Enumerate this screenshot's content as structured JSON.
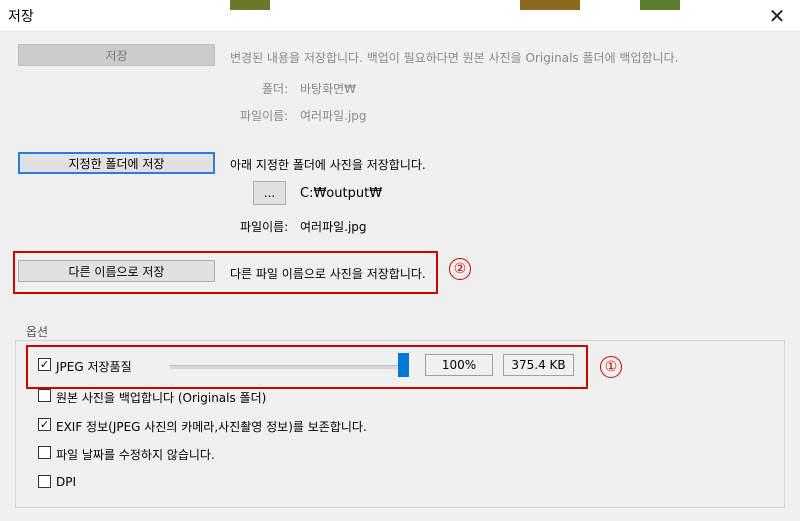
{
  "window": {
    "title": "저장",
    "close_glyph": "✕"
  },
  "save_section": {
    "button": "저장",
    "description": "변경된 내용을 저장합니다. 백업이 필요하다면 원본 사진을 Originals 폴더에 백업합니다.",
    "folder_label": "폴더:",
    "folder_value": "바탕화면₩",
    "filename_label": "파일이름:",
    "filename_value": "여러파일.jpg"
  },
  "folder_section": {
    "button": "지정한 폴더에 저장",
    "description": "아래 지정한 폴더에 사진을 저장합니다.",
    "browse_button": "...",
    "folder_value": "C:₩output₩",
    "filename_label": "파일이름:",
    "filename_value": "여러파일.jpg"
  },
  "saveas_section": {
    "button": "다른 이름으로 저장",
    "description": "다른 파일 이름으로 사진을 저장합니다."
  },
  "options": {
    "group_label": "옵션",
    "jpeg_quality_label": "JPEG 저장품질",
    "jpeg_quality_checked": true,
    "quality_level": 1.0,
    "quality_percent": "100%",
    "estimated_size": "375.4 KB",
    "backup_label": "원본 사진을 백업합니다 (Originals 폴더)",
    "backup_checked": false,
    "exif_label": "EXIF 정보(JPEG 사진의 카메라,사진촬영 정보)를 보존합니다.",
    "exif_checked": true,
    "keep_date_label": "파일 날짜를 수정하지 않습니다.",
    "keep_date_checked": false,
    "dpi_label": "DPI",
    "dpi_checked": false
  },
  "annotations": {
    "marker_1": "①",
    "marker_2": "②",
    "color": "#d10000"
  },
  "colors": {
    "accent": "#0078d7",
    "highlight": "#d10000",
    "background": "#f0f0f0"
  }
}
